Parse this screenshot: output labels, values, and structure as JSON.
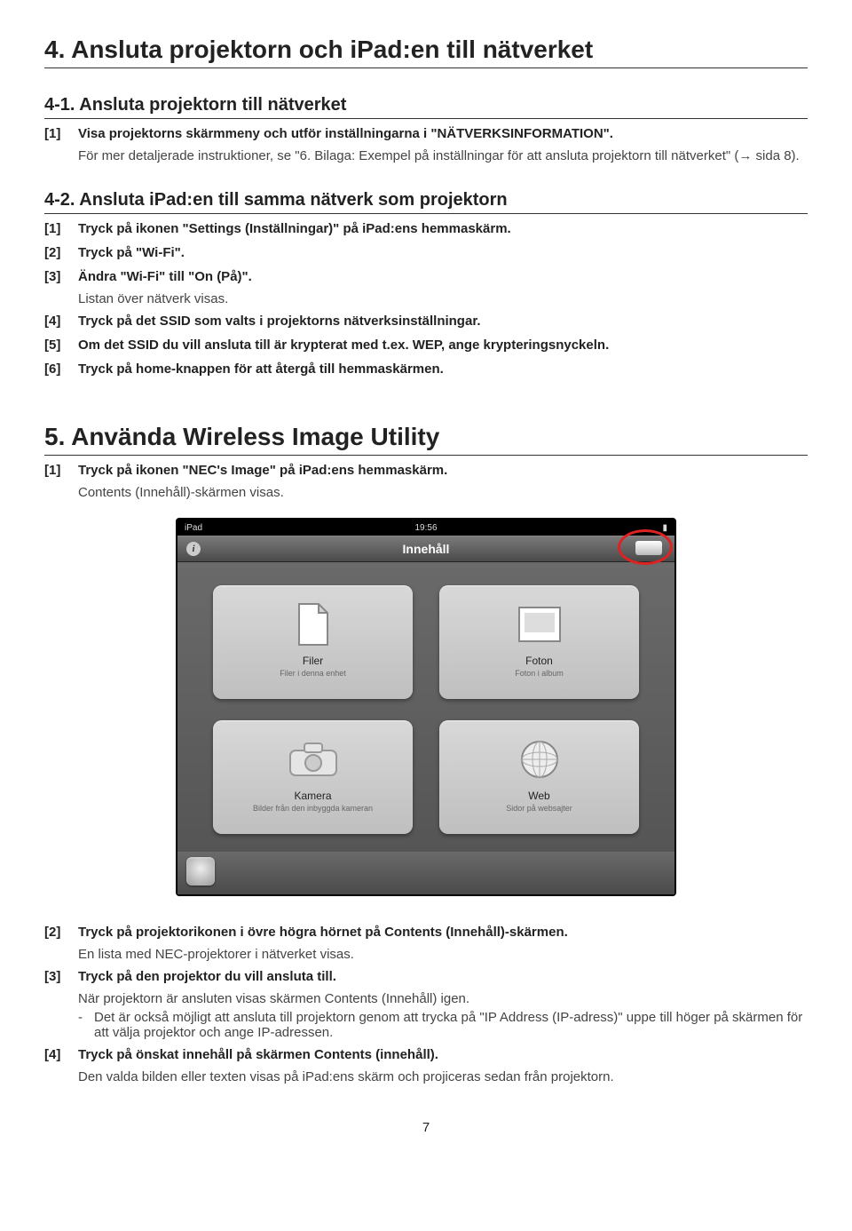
{
  "s4": {
    "title": "4. Ansluta projektorn och iPad:en till nätverket",
    "s41": {
      "title": "4-1. Ansluta projektorn till nätverket",
      "step1": "[1]",
      "step1_text": "Visa projektorns skärmmeny och utför inställningarna i \"NÄTVERKSINFORMATION\".",
      "step1_note": "För mer detaljerade instruktioner, se \"6. Bilaga: Exempel på inställningar för att ansluta projektorn till nätverket\" (→ sida 8)."
    },
    "s42": {
      "title": "4-2. Ansluta iPad:en till samma nätverk som projektorn",
      "step1": "[1]",
      "step1_text": "Tryck på ikonen \"Settings (Inställningar)\" på iPad:ens hemmaskärm.",
      "step2": "[2]",
      "step2_text": "Tryck på \"Wi-Fi\".",
      "step3": "[3]",
      "step3_text": "Ändra \"Wi-Fi\" till \"On (På)\".",
      "step3_note": "Listan över nätverk visas.",
      "step4": "[4]",
      "step4_text": "Tryck på det SSID som valts i projektorns nätverksinställningar.",
      "step5": "[5]",
      "step5_text": "Om det SSID du vill ansluta till är krypterat med t.ex. WEP, ange krypteringsnyckeln.",
      "step6": "[6]",
      "step6_text": "Tryck på home-knappen för att återgå till hemmaskärmen."
    }
  },
  "s5": {
    "title": "5. Använda Wireless Image Utility",
    "step1": "[1]",
    "step1_text": "Tryck på ikonen \"NEC's Image\" på iPad:ens hemmaskärm.",
    "step1_note": "Contents (Innehåll)-skärmen visas.",
    "ipad": {
      "device": "iPad",
      "time": "19:56",
      "header": "Innehåll",
      "tiles": [
        {
          "label": "Filer",
          "sub": "Filer i denna enhet"
        },
        {
          "label": "Foton",
          "sub": "Foton i album"
        },
        {
          "label": "Kamera",
          "sub": "Bilder från den inbyggda kameran"
        },
        {
          "label": "Web",
          "sub": "Sidor på websajter"
        }
      ]
    },
    "step2": "[2]",
    "step2_text": "Tryck på projektorikonen i övre högra hörnet på Contents (Innehåll)-skärmen.",
    "step2_note": "En lista med NEC-projektorer i nätverket visas.",
    "step3": "[3]",
    "step3_text": "Tryck på den projektor du vill ansluta till.",
    "step3_note": "När projektorn är ansluten visas skärmen Contents (Innehåll) igen.",
    "step3_sub_dash": "-",
    "step3_sub": "Det är också möjligt att ansluta till projektorn genom att trycka på \"IP Address (IP-adress)\" uppe till höger på skärmen för att välja projektor och ange IP-adressen.",
    "step4": "[4]",
    "step4_text": "Tryck på önskat innehåll på skärmen Contents (innehåll).",
    "step4_note": "Den valda bilden eller texten visas på iPad:ens skärm och projiceras sedan från projektorn."
  },
  "page": "7"
}
